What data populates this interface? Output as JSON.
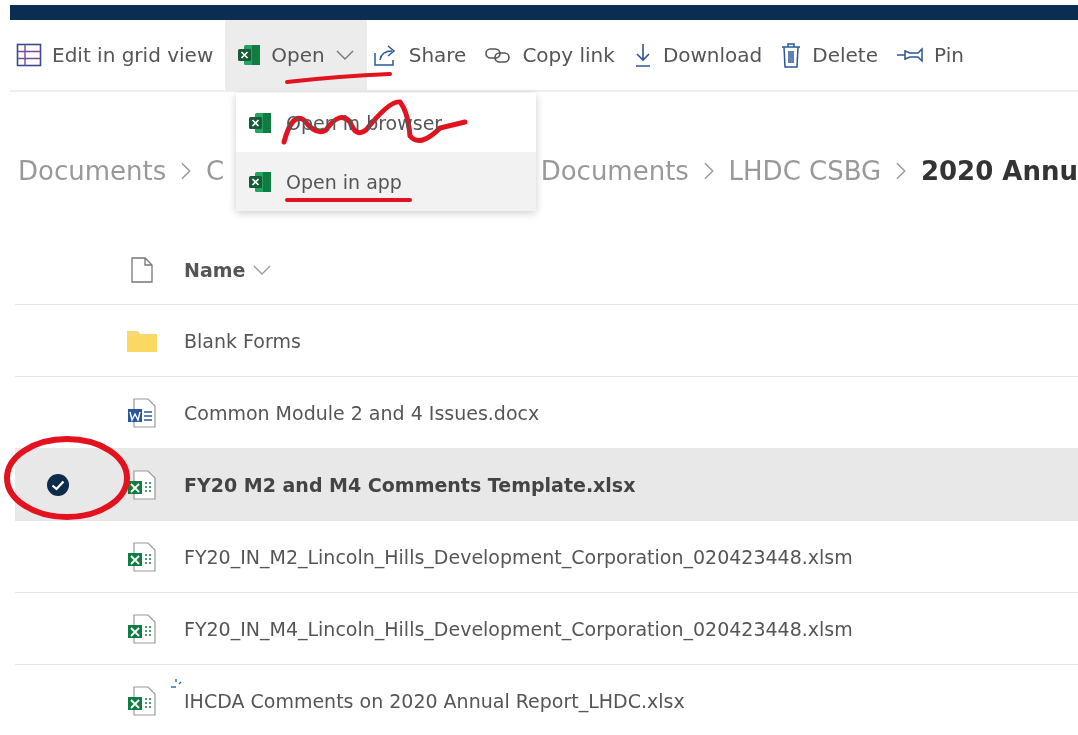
{
  "toolbar": [
    {
      "kind": "grid",
      "label": "Edit in grid view",
      "selected": false
    },
    {
      "kind": "excel",
      "label": "Open",
      "selected": true,
      "dropdown": true
    },
    {
      "kind": "share",
      "label": "Share",
      "selected": false
    },
    {
      "kind": "link",
      "label": "Copy link",
      "selected": false
    },
    {
      "kind": "download",
      "label": "Download",
      "selected": false
    },
    {
      "kind": "delete",
      "label": "Delete",
      "selected": false
    },
    {
      "kind": "pin",
      "label": "Pin",
      "selected": false
    }
  ],
  "menu": [
    {
      "label": "Open in browser",
      "selected": false
    },
    {
      "label": "Open in app",
      "selected": true
    }
  ],
  "breadcrumb": [
    {
      "label": "Documents",
      "current": false,
      "covered": false
    },
    {
      "label": "C",
      "current": false,
      "covered": true
    },
    {
      "label": "Documents",
      "current": false,
      "covered": false
    },
    {
      "label": "LHDC CSBG",
      "current": false,
      "covered": false
    },
    {
      "label": "2020 Annu",
      "current": true,
      "covered": false
    }
  ],
  "table": {
    "columns": [
      {
        "label": "Name"
      }
    ],
    "rows": [
      {
        "kind": "folder",
        "name": "Blank Forms",
        "selected": false,
        "syncing": false
      },
      {
        "kind": "word",
        "name": "Common Module 2 and 4 Issues.docx",
        "selected": false,
        "syncing": false
      },
      {
        "kind": "excel",
        "name": "FY20 M2 and M4 Comments Template.xlsx",
        "selected": true,
        "syncing": false
      },
      {
        "kind": "excel",
        "name": "FY20_IN_M2_Lincoln_Hills_Development_Corporation_020423448.xlsm",
        "selected": false,
        "syncing": false
      },
      {
        "kind": "excel",
        "name": "FY20_IN_M4_Lincoln_Hills_Development_Corporation_020423448.xlsm",
        "selected": false,
        "syncing": false
      },
      {
        "kind": "excel",
        "name": "IHCDA Comments on 2020 Annual Report_LHDC.xlsx",
        "selected": false,
        "syncing": true
      }
    ]
  }
}
